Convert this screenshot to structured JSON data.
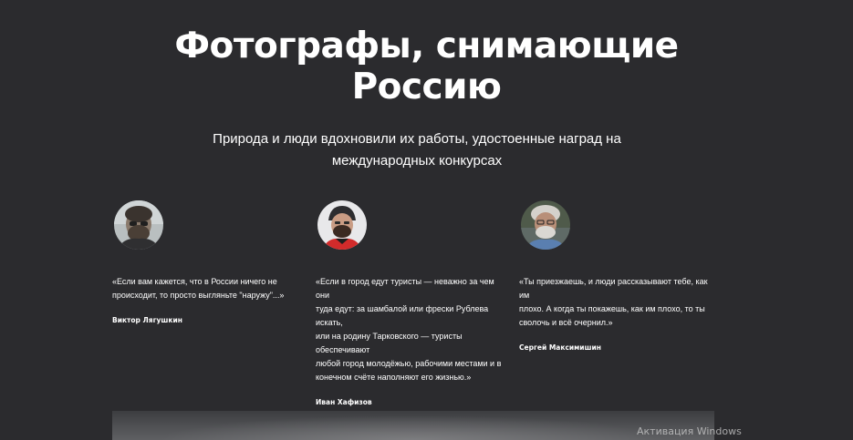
{
  "header": {
    "title_line1": "Фотографы, снимающие",
    "title_line2": "Россию",
    "subtitle_line1": "Природа и люди вдохновили их работы, удостоенные наград на",
    "subtitle_line2": "международных конкурсах"
  },
  "photographers": [
    {
      "quote_lines": [
        "«Если вам кажется, что в России ничего не",
        "происходит, то просто выгляньте \"наружу\"...»"
      ],
      "name": "Виктор Лягушкин"
    },
    {
      "quote_lines": [
        "«Если в город едут туристы — неважно за чем они",
        "туда едут: за шамбалой или фрески Рублева искать,",
        "или на родину Тарковского — туристы обеспечивают",
        "любой город молодёжью, рабочими местами и в",
        "конечном счёте наполняют его жизнью.»"
      ],
      "name": "Иван Хафизов"
    },
    {
      "quote_lines": [
        "«Ты приезжаешь, и люди рассказывают тебе, как им",
        "плохо. А когда ты покажешь, как им плохо, то ты",
        "сволочь и всё очернил.»"
      ],
      "name": "Сергей Максимишин"
    }
  ],
  "system": {
    "activation_watermark": "Активация Windows"
  }
}
